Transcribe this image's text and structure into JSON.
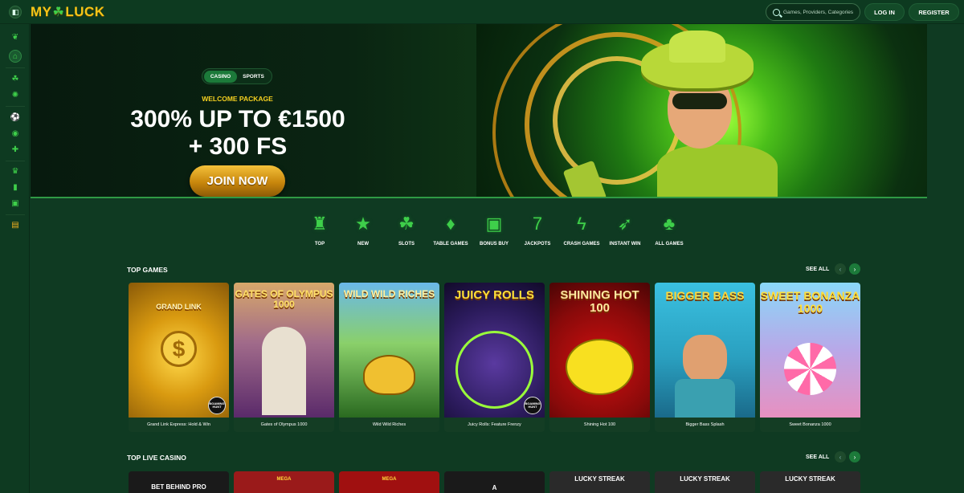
{
  "header": {
    "logo_left": "MY",
    "logo_right": "LUCK",
    "search_placeholder": "Games, Providers, Categories",
    "login_label": "LOG IN",
    "register_label": "REGISTER"
  },
  "sidebar": {
    "icons": [
      "leaf-icon",
      "home-icon",
      "clover-icon",
      "roulette-icon",
      "sports-icon",
      "live-icon",
      "controller-icon",
      "trophy-icon",
      "stats-icon",
      "gift-icon",
      "ticket-icon"
    ]
  },
  "hero": {
    "tabs": [
      "CASINO",
      "SPORTS"
    ],
    "welcome": "WELCOME PACKAGE",
    "line1": "300% UP TO €1500",
    "line2": "+ 300 FS",
    "cta": "JOIN NOW"
  },
  "categories": [
    {
      "label": "TOP",
      "icon": "top-hat-icon"
    },
    {
      "label": "NEW",
      "icon": "star-icon"
    },
    {
      "label": "SLOTS",
      "icon": "clover-icon"
    },
    {
      "label": "TABLE GAMES",
      "icon": "card-icon"
    },
    {
      "label": "BONUS BUY",
      "icon": "gift-icon"
    },
    {
      "label": "JACKPOTS",
      "icon": "seven-icon"
    },
    {
      "label": "CRASH GAMES",
      "icon": "lightning-icon"
    },
    {
      "label": "INSTANT WIN",
      "icon": "rocket-icon"
    },
    {
      "label": "ALL GAMES",
      "icon": "cherries-icon"
    }
  ],
  "top_games": {
    "title": "TOP GAMES",
    "see_all": "SEE ALL",
    "games": [
      {
        "name": "Grand Link Express: Hold & Win",
        "art": "GRAND LINK",
        "bg": "#c8a020"
      },
      {
        "name": "Gates of Olympus 1000",
        "art": "GATES OF OLYMPUS 1000",
        "bg": "#7a4a8a"
      },
      {
        "name": "Wild Wild Riches",
        "art": "WILD WILD RICHES",
        "bg": "#3a7a30"
      },
      {
        "name": "Juicy Rolls: Feature Frenzy",
        "art": "JUICY ROLLS",
        "bg": "#2a1a5a"
      },
      {
        "name": "Shining Hot 100",
        "art": "SHINING HOT 100",
        "bg": "#8a0a0a"
      },
      {
        "name": "Bigger Bass Splash",
        "art": "BIGGER BASS",
        "bg": "#2aa0c0"
      },
      {
        "name": "Sweet Bonanza 1000",
        "art": "SWEET BONANZA 1000",
        "bg": "#6ac0e8"
      }
    ],
    "badge": "BGAMING HUNT"
  },
  "top_live_casino": {
    "title": "TOP LIVE CASINO",
    "see_all": "SEE ALL",
    "cards": [
      {
        "art": "BET BEHIND PRO",
        "bg": "#1a1a1a"
      },
      {
        "art": "MEGA",
        "bg": "#9a1a1a"
      },
      {
        "art": "MEGA",
        "bg": "#a01010"
      },
      {
        "art": "A",
        "bg": "#1a1a1a"
      },
      {
        "art": "LUCKY STREAK",
        "bg": "#2a2a2a"
      },
      {
        "art": "LUCKY STREAK",
        "bg": "#2a2a2a"
      },
      {
        "art": "LUCKY STREAK",
        "bg": "#2a2a2a"
      }
    ]
  }
}
